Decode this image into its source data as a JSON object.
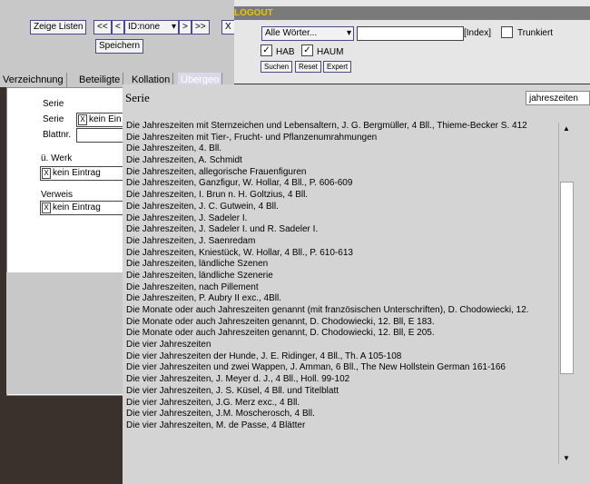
{
  "toolbar": {
    "show_lists_label": "Zeige Listen",
    "first_label": "<<",
    "prev_label": "<",
    "id_select_value": "ID:none",
    "next_label": ">",
    "last_label": ">>",
    "x_label": "X",
    "save_label": "Speichern"
  },
  "tabs": [
    "Verzeichnung",
    "Beteiligte",
    "Kollation",
    "Übergeo"
  ],
  "form": {
    "section_serie": "Serie",
    "serie_label": "Serie",
    "serie_value": "kein Ein",
    "blattnr_label": "Blattnr.",
    "uwerk_label": "ü. Werk",
    "uwerk_value": "kein Eintrag",
    "verweis_label": "Verweis",
    "verweis_value": "kein Eintrag",
    "x_mark": "X"
  },
  "search": {
    "logout_label": "LOGOUT",
    "field_select": "Alle Wörter...",
    "index_label": "[Index]",
    "truncate_label": "Trunkiert",
    "hab_label": "HAB",
    "haum_label": "HAUM",
    "search_button": "Suchen",
    "reset_button": "Reset",
    "expert_button": "Expert",
    "check_mark": "✓"
  },
  "popup": {
    "title": "Serie",
    "search_value": "jahreszeiten",
    "items": [
      "Die Jahreszeiten mit Sternzeichen und Lebensaltern, J. G. Bergmüller, 4 Bll., Thieme-Becker S. 412",
      "Die Jahreszeiten mit Tier-, Frucht- und Pflanzenumrahmungen",
      "Die Jahreszeiten, 4. Bll.",
      "Die Jahreszeiten, A. Schmidt",
      "Die Jahreszeiten, allegorische Frauenfiguren",
      "Die Jahreszeiten, Ganzfigur, W. Hollar, 4 Bll., P. 606-609",
      "Die Jahreszeiten, I. Brun n. H. Goltzius, 4 Bll.",
      "Die Jahreszeiten, J. C. Gutwein, 4 Bll.",
      "Die Jahreszeiten, J. Sadeler I.",
      "Die Jahreszeiten, J. Sadeler I. und R. Sadeler I.",
      "Die Jahreszeiten, J. Saenredam",
      "Die Jahreszeiten, Kniestück, W. Hollar, 4 Bll., P. 610-613",
      "Die Jahreszeiten, ländliche Szenen",
      "Die Jahreszeiten, ländliche Szenerie",
      "Die Jahreszeiten, nach Pillement",
      "Die Jahreszeiten, P. Aubry II exc., 4Bll.",
      "Die Monate oder auch Jahreszeiten genannt (mit französischen Unterschriften), D. Chodowiecki, 12.",
      "Die Monate oder auch Jahreszeiten genannt, D. Chodowiecki, 12. Bll, E 183.",
      "Die Monate oder auch Jahreszeiten genannt, D. Chodowiecki, 12. Bll, E 205.",
      "Die vier Jahreszeiten",
      "Die vier Jahreszeiten der Hunde, J. E. Ridinger, 4 Bll., Th. A 105-108",
      "Die vier Jahreszeiten und zwei Wappen, J. Amman, 6 Bll., The New Hollstein German 161-166",
      "Die vier Jahreszeiten, J. Meyer d. J., 4 Bll., Holl. 99-102",
      "Die vier Jahreszeiten, J. S. Küsel, 4 Bll. und Titelblatt",
      "Die vier Jahreszeiten, J.G. Merz exc., 4 Bll.",
      "Die vier Jahreszeiten, J.M. Moscherosch, 4 Bll.",
      "Die vier Jahreszeiten, M. de Passe, 4 Blätter"
    ]
  }
}
